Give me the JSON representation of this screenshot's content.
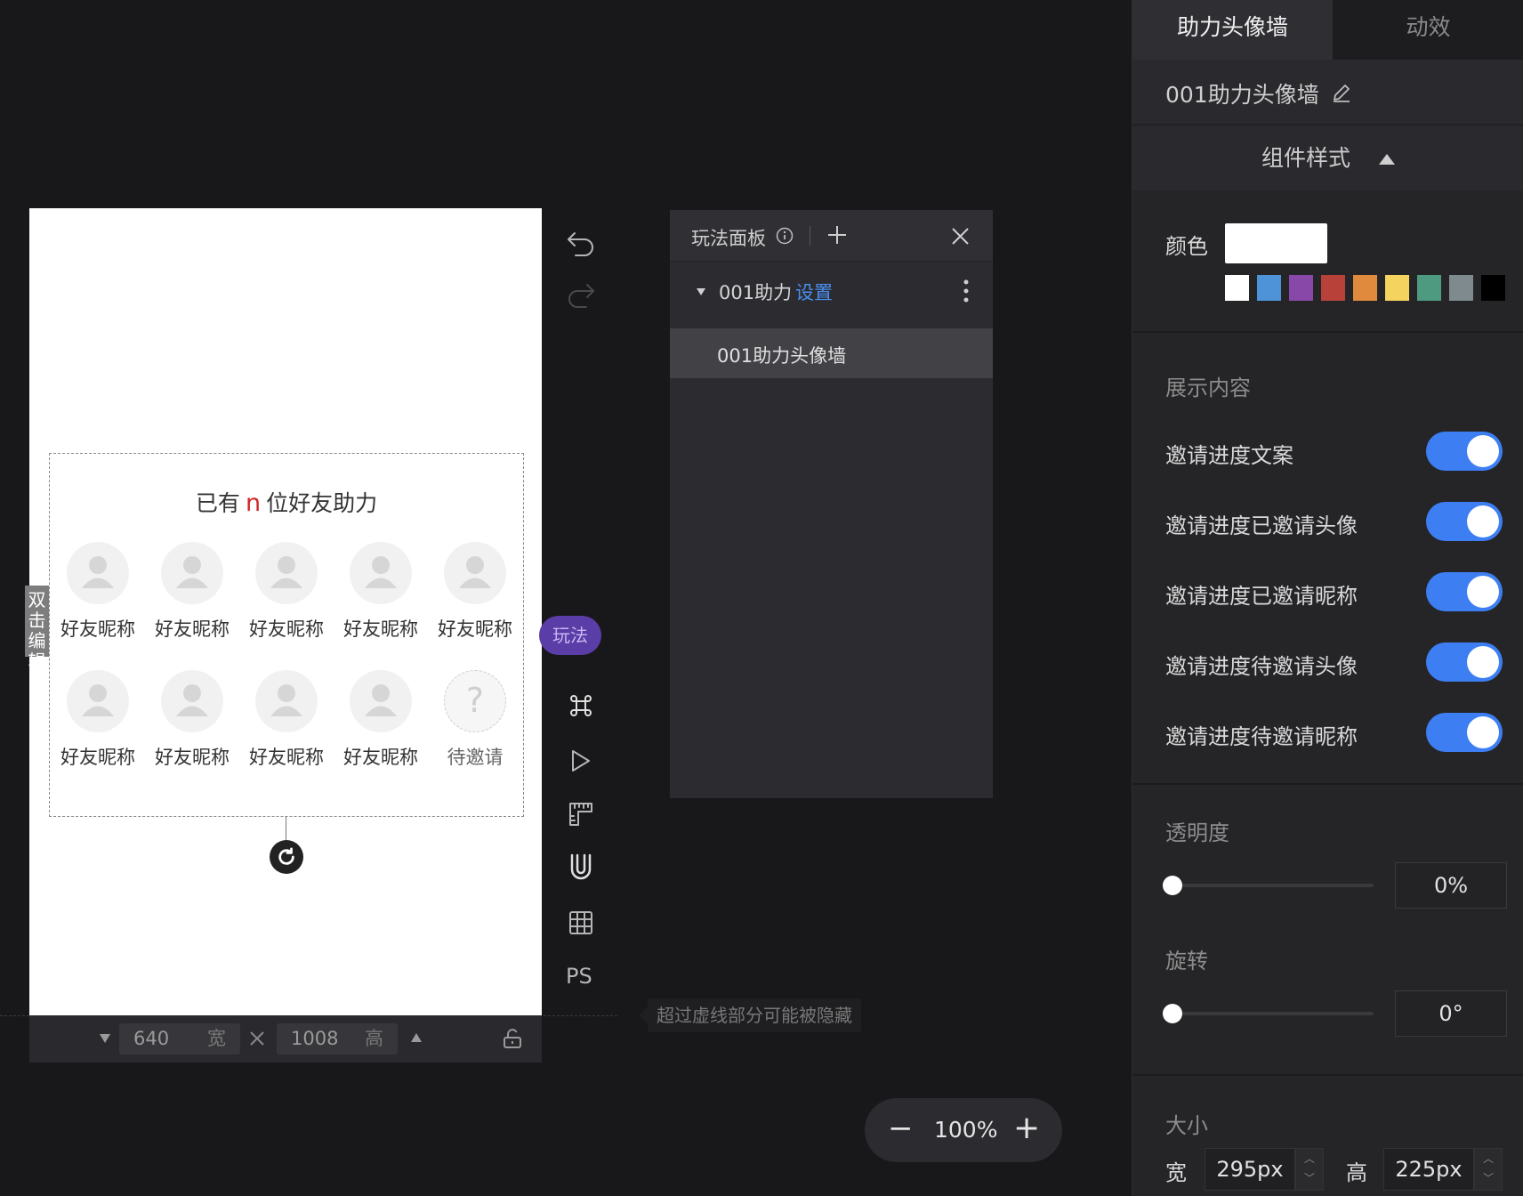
{
  "canvas": {
    "double_click_edit": "双击编辑",
    "widget": {
      "title_prefix": "已有",
      "title_highlight": "n",
      "title_suffix": "位好友助力",
      "slots": [
        {
          "label": "好友昵称",
          "state": "friend"
        },
        {
          "label": "好友昵称",
          "state": "friend"
        },
        {
          "label": "好友昵称",
          "state": "friend"
        },
        {
          "label": "好友昵称",
          "state": "friend"
        },
        {
          "label": "好友昵称",
          "state": "friend"
        },
        {
          "label": "好友昵称",
          "state": "friend"
        },
        {
          "label": "好友昵称",
          "state": "friend"
        },
        {
          "label": "好友昵称",
          "state": "friend"
        },
        {
          "label": "好友昵称",
          "state": "friend"
        },
        {
          "label": "待邀请",
          "state": "pending",
          "glyph": "?"
        }
      ]
    },
    "size_bar": {
      "width_value": "640",
      "width_unit": "宽",
      "height_value": "1008",
      "height_unit": "高"
    }
  },
  "toolbar": {
    "play_label": "玩法",
    "ps_label": "PS"
  },
  "hint": "超过虚线部分可能被隐藏",
  "layer_panel": {
    "title": "玩法面板",
    "group_name": "001助力",
    "group_action": "设置",
    "item": "001助力头像墙"
  },
  "zoom": {
    "minus": "−",
    "value": "100%",
    "plus": "+"
  },
  "right_panel": {
    "tabs": [
      "助力头像墙",
      "动效"
    ],
    "active_tab": 0,
    "component_name": "001助力头像墙",
    "section_title": "组件样式",
    "color_label": "颜色",
    "color_value": "#ffffff",
    "swatches": [
      "#ffffff",
      "#4e92d8",
      "#8848a8",
      "#b8423a",
      "#df8a3c",
      "#f4d35e",
      "#4e9a80",
      "#7e8a8e",
      "#000000"
    ],
    "display_title": "展示内容",
    "toggles": [
      {
        "label": "邀请进度文案",
        "on": true
      },
      {
        "label": "邀请进度已邀请头像",
        "on": true
      },
      {
        "label": "邀请进度已邀请昵称",
        "on": true
      },
      {
        "label": "邀请进度待邀请头像",
        "on": true
      },
      {
        "label": "邀请进度待邀请昵称",
        "on": true
      }
    ],
    "opacity_label": "透明度",
    "opacity_value": "0%",
    "rotation_label": "旋转",
    "rotation_value": "0°",
    "size_label": "大小",
    "width_label": "宽",
    "width_value": "295px",
    "height_label": "高",
    "height_value": "225px"
  },
  "colors": {
    "accent": "#3d7ff3",
    "play_pill": "#5a3da6",
    "highlight": "#d0262a"
  }
}
